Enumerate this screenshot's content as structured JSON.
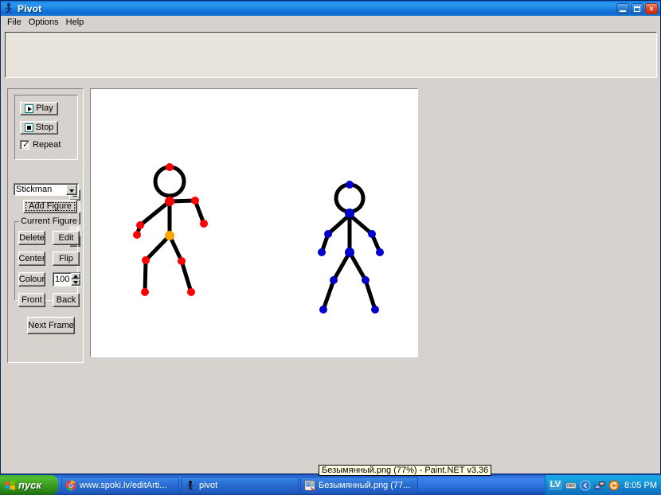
{
  "window": {
    "title": "Pivot",
    "title_icon": "stickman-icon",
    "buttons": {
      "minimize": "minimize-icon",
      "maximize": "maximize-icon",
      "close": "×"
    }
  },
  "menu": {
    "items": [
      {
        "label": "File"
      },
      {
        "label": "Options"
      },
      {
        "label": "Help"
      }
    ]
  },
  "controls": {
    "animation": {
      "play_label": "Play",
      "stop_label": "Stop",
      "repeat_label": "Repeat",
      "repeat_checked": true,
      "check_glyph": "✓"
    },
    "figure_type": {
      "selected": "Stickman",
      "options": [
        "Stickman"
      ]
    },
    "add_figure_label": "Add Figure",
    "current_figure": {
      "legend": "Current Figure",
      "delete_label": "Delete",
      "edit_label": "Edit",
      "center_label": "Center",
      "flip_label": "Flip",
      "colour_label": "Colour",
      "front_label": "Front",
      "back_label": "Back",
      "size_value": "100"
    },
    "next_frame_label": "Next Frame"
  },
  "canvas": {
    "background": "#ffffff",
    "figures": [
      {
        "name": "stickman-red",
        "joint_color": "#ff0000",
        "center_joint_color": "#ffa500",
        "limb_color": "#000000",
        "selected": true
      },
      {
        "name": "stickman-blue",
        "joint_color": "#0000cc",
        "limb_color": "#000000",
        "selected": false
      }
    ]
  },
  "tooltip": {
    "text": "Безымянный.png (77%) - Paint.NET v3.36"
  },
  "taskbar": {
    "start_label": "пуск",
    "items": [
      {
        "label": "www.spoki.lv/editArti...",
        "icon": "chrome-icon"
      },
      {
        "label": "pivot",
        "icon": "stickman-icon"
      },
      {
        "label": "Безымянный.png (77...",
        "icon": "paintnet-icon"
      }
    ],
    "tray": {
      "language": "LV",
      "icons": [
        "keyboard-icon",
        "chevron-left-icon",
        "network-icon",
        "update-icon"
      ],
      "clock": "8:05 PM"
    }
  }
}
